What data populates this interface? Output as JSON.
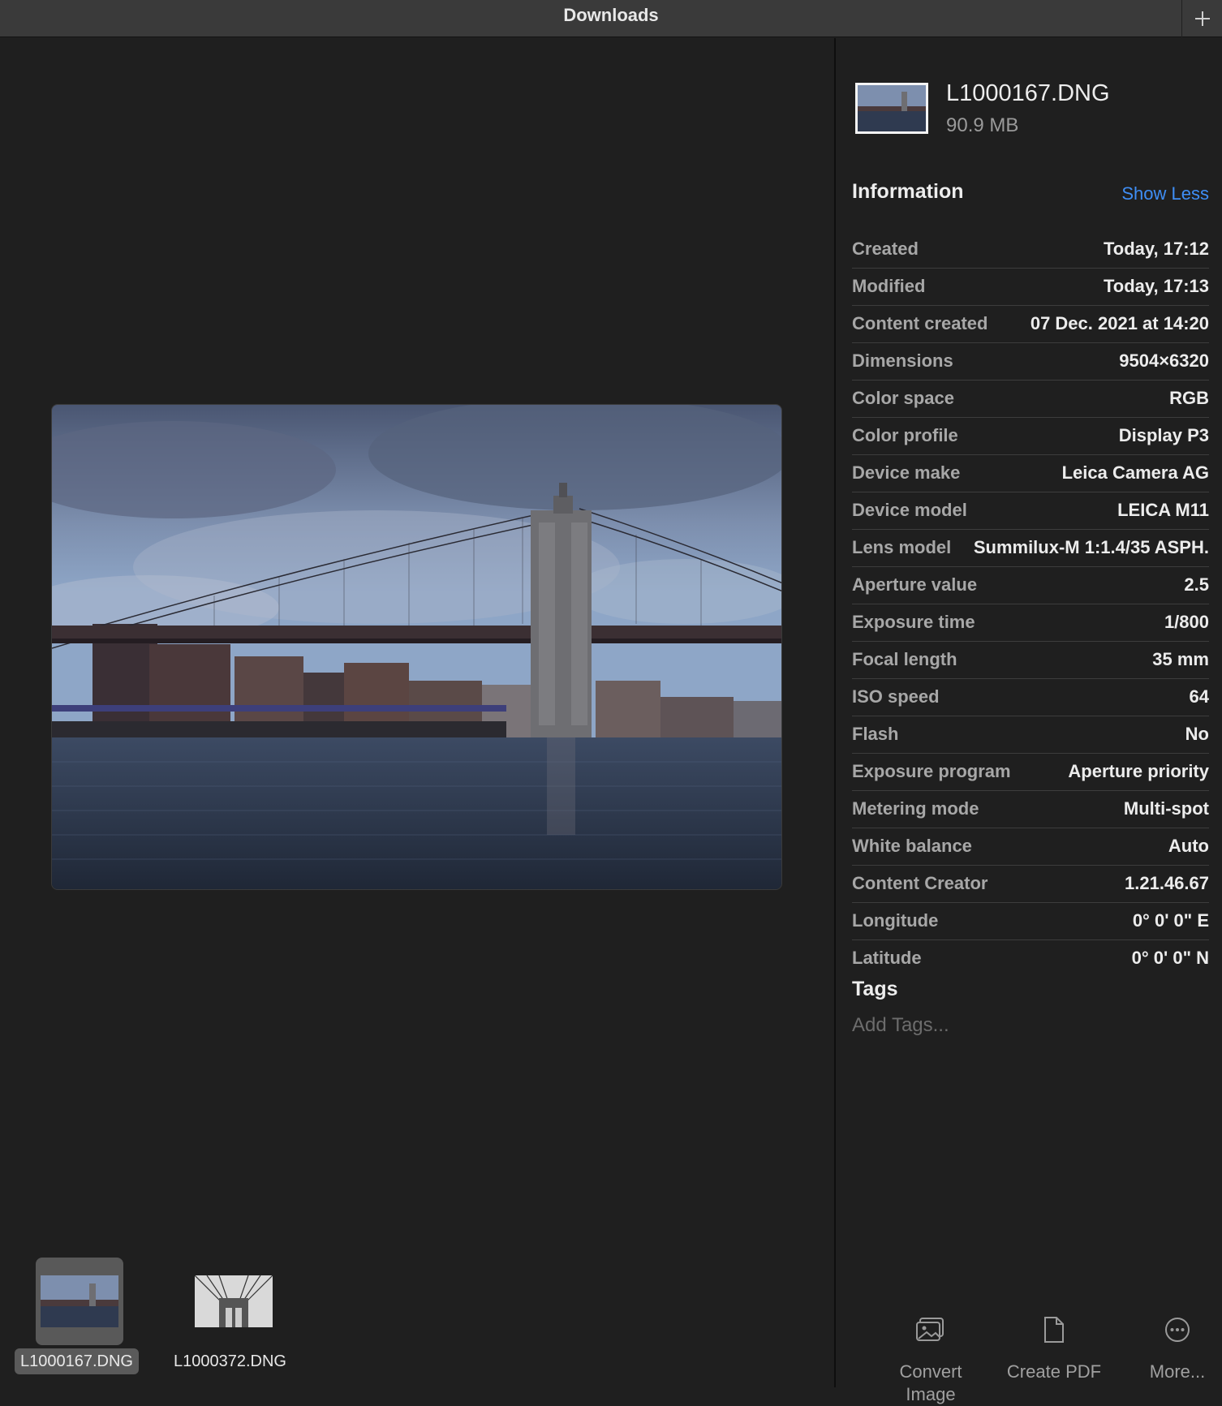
{
  "window": {
    "title": "Downloads",
    "add_icon": "plus-icon"
  },
  "preview": {
    "image_alt": "Brooklyn Bridge over river under cloudy sky"
  },
  "thumbnails": [
    {
      "label": "L1000167.DNG",
      "selected": true
    },
    {
      "label": "L1000372.DNG",
      "selected": false
    }
  ],
  "file": {
    "name": "L1000167.DNG",
    "size": "90.9 MB"
  },
  "information": {
    "heading": "Information",
    "toggle_label": "Show Less",
    "rows": [
      {
        "key": "Created",
        "value": "Today, 17:12"
      },
      {
        "key": "Modified",
        "value": "Today, 17:13"
      },
      {
        "key": "Content created",
        "value": "07 Dec. 2021 at 14:20"
      },
      {
        "key": "Dimensions",
        "value": "9504×6320"
      },
      {
        "key": "Color space",
        "value": "RGB"
      },
      {
        "key": "Color profile",
        "value": "Display P3"
      },
      {
        "key": "Device make",
        "value": "Leica Camera AG"
      },
      {
        "key": "Device model",
        "value": "LEICA M11"
      },
      {
        "key": "Lens model",
        "value": "Summilux-M 1:1.4/35 ASPH."
      },
      {
        "key": "Aperture value",
        "value": "2.5"
      },
      {
        "key": "Exposure time",
        "value": "1/800"
      },
      {
        "key": "Focal length",
        "value": "35 mm"
      },
      {
        "key": "ISO speed",
        "value": "64"
      },
      {
        "key": "Flash",
        "value": "No"
      },
      {
        "key": "Exposure program",
        "value": "Aperture priority"
      },
      {
        "key": "Metering mode",
        "value": "Multi-spot"
      },
      {
        "key": "White balance",
        "value": "Auto"
      },
      {
        "key": "Content Creator",
        "value": "1.21.46.67"
      },
      {
        "key": "Longitude",
        "value": "0° 0' 0\" E"
      },
      {
        "key": "Latitude",
        "value": "0° 0' 0\" N"
      }
    ]
  },
  "tags": {
    "heading": "Tags",
    "placeholder": "Add Tags..."
  },
  "actions": [
    {
      "label": "Convert Image",
      "icon": "convert-image-icon"
    },
    {
      "label": "Create PDF",
      "icon": "document-icon"
    },
    {
      "label": "More...",
      "icon": "ellipsis-circle-icon"
    }
  ],
  "colors": {
    "background": "#1f1f1f",
    "titlebar": "#3a3a3a",
    "link": "#3f8ef5"
  }
}
